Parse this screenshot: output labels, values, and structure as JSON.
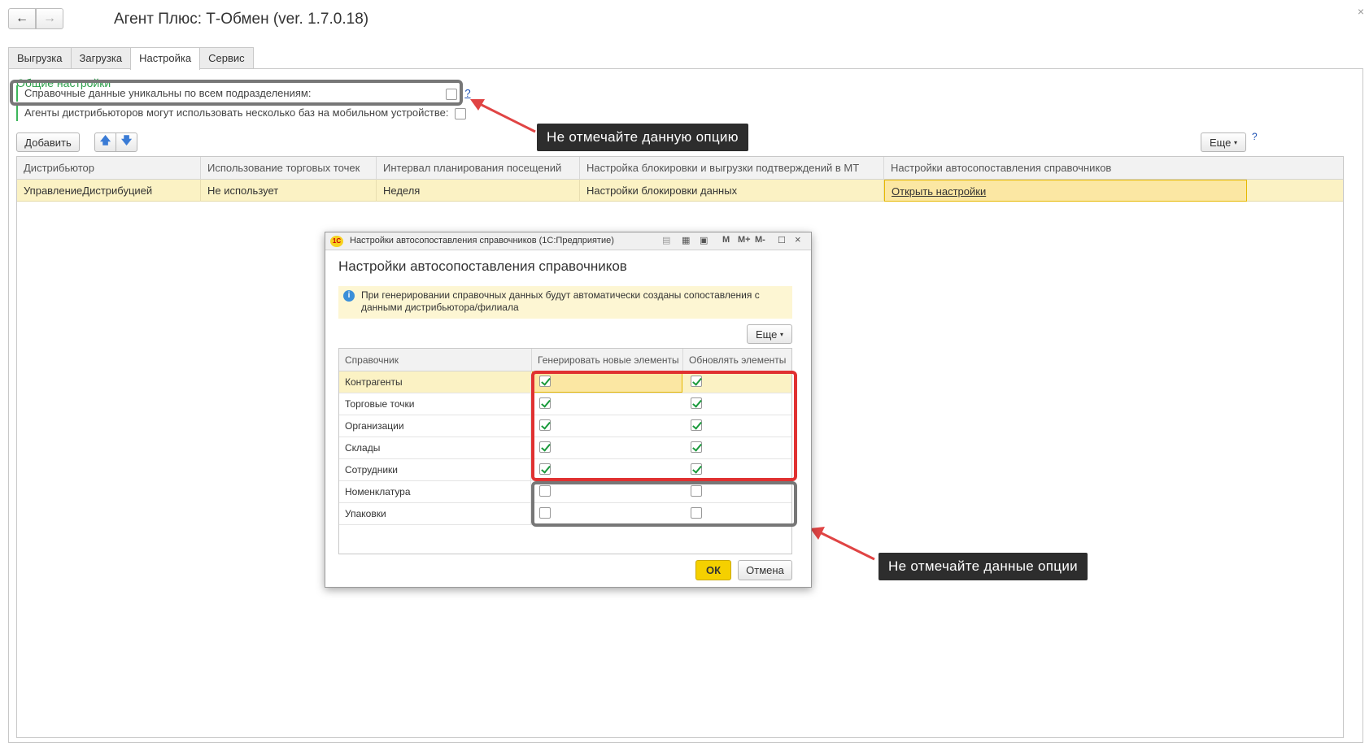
{
  "window": {
    "title": "Агент Плюс: Т-Обмен (ver. 1.7.0.18)",
    "back_icon": "←",
    "forward_icon": "→",
    "close_icon": "×"
  },
  "tabs": [
    "Выгрузка",
    "Загрузка",
    "Настройка",
    "Сервис"
  ],
  "active_tab": "Настройка",
  "general": {
    "group_title": "Общие настройки",
    "option1_label": "Справочные данные уникальны по всем подразделениям:",
    "option1_help": "?",
    "option2_label": "Агенты дистрибьюторов могут использовать несколько баз на мобильном устройстве:"
  },
  "toolbar": {
    "add_label": "Добавить",
    "up_icon": "🡅",
    "down_icon": "🡇",
    "more_label": "Еще",
    "help": "?"
  },
  "table": {
    "columns": [
      "Дистрибьютор",
      "Использование торговых точек",
      "Интервал планирования посещений",
      "Настройка блокировки и выгрузки подтверждений в МТ",
      "Настройки автосопоставления справочников"
    ],
    "rows": [
      {
        "distributor": "УправлениеДистрибуцией",
        "outlets": "Не использует",
        "interval": "Неделя",
        "lock": "Настройки блокировки данных",
        "mapping": "Открыть настройки"
      }
    ]
  },
  "callouts": {
    "top": "Не отмечайте данную опцию",
    "bottom": "Не отмечайте данные опции"
  },
  "dialog": {
    "window_title": "Настройки автосопоставления справочников  (1С:Предприятие)",
    "logo": "1С",
    "tools": [
      "M",
      "M+",
      "M-"
    ],
    "heading": "Настройки автосопоставления справочников",
    "info": "При генерировании справочных данных будут автоматически созданы сопоставления с данными дистрибьютора/филиала",
    "more_label": "Еще",
    "columns": [
      "Справочник",
      "Генерировать новые элементы",
      "Обновлять элементы"
    ],
    "rows": [
      {
        "name": "Контрагенты",
        "generate": true,
        "update": true
      },
      {
        "name": "Торговые точки",
        "generate": true,
        "update": true
      },
      {
        "name": "Организации",
        "generate": true,
        "update": true
      },
      {
        "name": "Склады",
        "generate": true,
        "update": true
      },
      {
        "name": "Сотрудники",
        "generate": true,
        "update": true
      },
      {
        "name": "Номенклатура",
        "generate": false,
        "update": false
      },
      {
        "name": "Упаковки",
        "generate": false,
        "update": false
      }
    ],
    "ok_label": "ОК",
    "cancel_label": "Отмена"
  },
  "colors": {
    "accent_green": "#2c9e4a",
    "selection_yellow": "#fbf2c4",
    "ok_button": "#f5d000",
    "warning_outline": "#e03131",
    "callout_bg": "#2d2d2d"
  }
}
